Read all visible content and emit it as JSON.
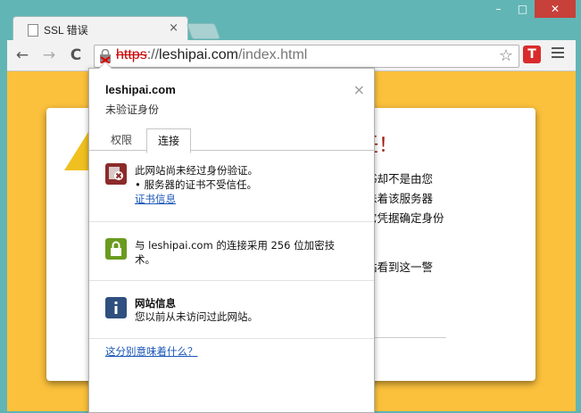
{
  "window": {
    "controls": {
      "minimize": "–",
      "maximize": "□",
      "close": "✕"
    }
  },
  "tab": {
    "title": "SSL 错误",
    "close": "×",
    "icon": "document-icon"
  },
  "toolbar": {
    "back": "←",
    "forward": "→",
    "reload": "C",
    "url_scheme": "https",
    "url_host": "leshipai.com",
    "url_path": "/index.html",
    "url_separator": "://",
    "star": "☆",
    "extension_label": "T"
  },
  "page": {
    "title": "任！",
    "lines": [
      "书却不是由您",
      "味着该服务器",
      "它凭据确定身份",
      "站看到这一警"
    ],
    "background_color": "#fbc13c",
    "title_color": "#9c1b0d"
  },
  "popup": {
    "host": "leshipai.com",
    "subtitle": "未验证身份",
    "close": "×",
    "tabs": [
      {
        "label": "权限",
        "active": false
      },
      {
        "label": "连接",
        "active": true
      }
    ],
    "sections": [
      {
        "icon": "certificate-error-icon",
        "lines": [
          "此网站尚未经过身份验证。",
          "• 服务器的证书不受信任。"
        ],
        "link": "证书信息"
      },
      {
        "icon": "lock-icon",
        "lines": [
          "与 leshipai.com 的连接采用 256 位加密技",
          "术。"
        ]
      },
      {
        "icon": "info-icon",
        "title": "网站信息",
        "lines": [
          "您以前从未访问过此网站。"
        ]
      }
    ],
    "footer_link": "这分别意味着什么？"
  }
}
